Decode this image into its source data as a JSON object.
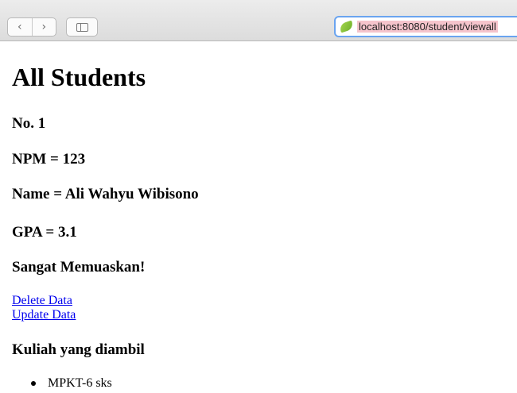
{
  "browser": {
    "back_icon": "chevron-left",
    "forward_icon": "chevron-right",
    "sidebar_icon": "sidebar",
    "site_icon": "spring-leaf",
    "url": "localhost:8080/student/viewall"
  },
  "page": {
    "title": "All Students",
    "student": {
      "no": "No. 1",
      "npm": "NPM = 123",
      "name": "Name = Ali Wahyu Wibisono",
      "gpa": "GPA = 3.1",
      "predicate": "Sangat Memuaskan!"
    },
    "links": {
      "delete": "Delete Data",
      "update": "Update Data"
    },
    "courses_heading": "Kuliah yang diambil",
    "courses": [
      "MPKT-6 sks"
    ]
  }
}
